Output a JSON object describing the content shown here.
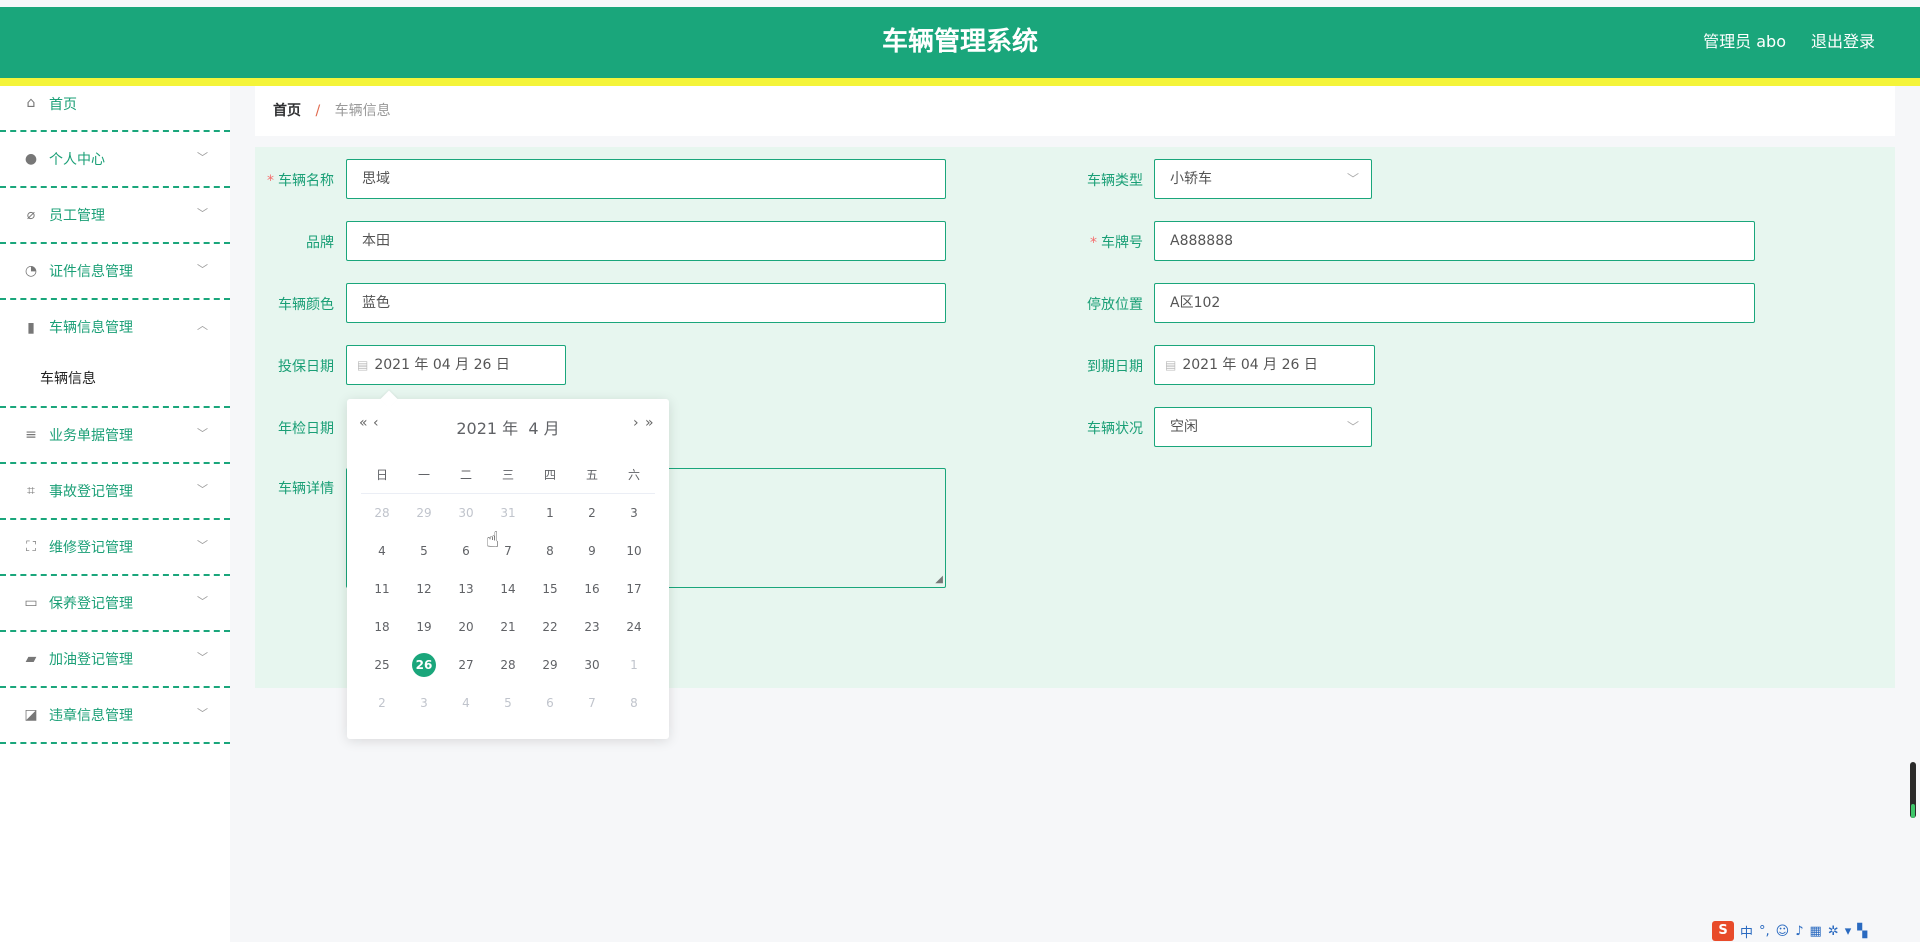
{
  "header": {
    "title": "车辆管理系统",
    "user": "管理员 abo",
    "logout": "退出登录"
  },
  "sidebar": {
    "items": [
      {
        "label": "首页",
        "icon": "home-icon"
      },
      {
        "label": "个人中心",
        "icon": "user-icon"
      },
      {
        "label": "员工管理",
        "icon": "bell-off-icon"
      },
      {
        "label": "证件信息管理",
        "icon": "gauge-icon"
      },
      {
        "label": "车辆信息管理",
        "icon": "bars-icon"
      },
      {
        "label": "业务单据管理",
        "icon": "list-icon"
      },
      {
        "label": "事故登记管理",
        "icon": "crop-icon"
      },
      {
        "label": "维修登记管理",
        "icon": "fullscreen-icon"
      },
      {
        "label": "保养登记管理",
        "icon": "card-icon"
      },
      {
        "label": "加油登记管理",
        "icon": "wallet-icon"
      },
      {
        "label": "违章信息管理",
        "icon": "chart-icon"
      }
    ],
    "sub": {
      "label": "车辆信息"
    }
  },
  "breadcrumb": {
    "home": "首页",
    "sep": "/",
    "current": "车辆信息"
  },
  "form": {
    "name": {
      "label": "车辆名称",
      "value": "思域"
    },
    "type": {
      "label": "车辆类型",
      "value": "小轿车"
    },
    "brand": {
      "label": "品牌",
      "value": "本田"
    },
    "plate": {
      "label": "车牌号",
      "value": "A888888"
    },
    "color": {
      "label": "车辆颜色",
      "value": "蓝色"
    },
    "location": {
      "label": "停放位置",
      "value": "A区102"
    },
    "insure": {
      "label": "投保日期",
      "value": "2021 年 04 月 26 日"
    },
    "expire": {
      "label": "到期日期",
      "value": "2021 年 04 月 26 日"
    },
    "inspect": {
      "label": "年检日期"
    },
    "status": {
      "label": "车辆状况",
      "value": "空闲"
    },
    "detail": {
      "label": "车辆详情"
    },
    "required": "*"
  },
  "datepicker": {
    "year": "2021 年",
    "month": "4 月",
    "prev_year": "«",
    "prev_month": "‹",
    "next_month": "›",
    "next_year": "»",
    "weekdays": [
      "日",
      "一",
      "二",
      "三",
      "四",
      "五",
      "六"
    ],
    "weeks": [
      [
        "28",
        "29",
        "30",
        "31",
        "1",
        "2",
        "3"
      ],
      [
        "4",
        "5",
        "6",
        "7",
        "8",
        "9",
        "10"
      ],
      [
        "11",
        "12",
        "13",
        "14",
        "15",
        "16",
        "17"
      ],
      [
        "18",
        "19",
        "20",
        "21",
        "22",
        "23",
        "24"
      ],
      [
        "25",
        "26",
        "27",
        "28",
        "29",
        "30",
        "1"
      ],
      [
        "2",
        "3",
        "4",
        "5",
        "6",
        "7",
        "8"
      ]
    ],
    "selected": "26"
  },
  "ime": {
    "logo": "S",
    "lang": "中"
  },
  "colors": {
    "primary": "#1aa67b",
    "accent_bar": "#f4f43a",
    "panel": "#e7f6ef",
    "required": "#f56c6c"
  }
}
